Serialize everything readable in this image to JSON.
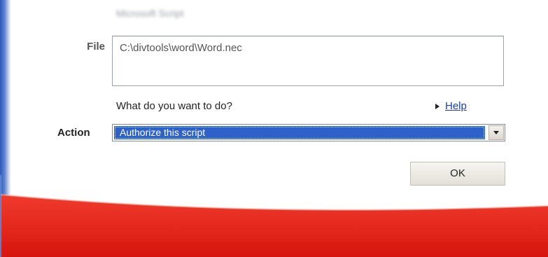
{
  "header": {
    "title": "Microsoft Script"
  },
  "file": {
    "label": "File",
    "path": "C:\\divtools\\word\\Word.nec"
  },
  "prompt": {
    "question": "What do you want to do?",
    "help_label": "Help"
  },
  "action": {
    "label": "Action",
    "selected": "Authorize this script"
  },
  "buttons": {
    "ok_label": "OK"
  },
  "colors": {
    "selection": "#2f62c9",
    "link": "#1a3fb0",
    "swoosh": "#e8231b",
    "accent_blue": "#2d5ab8"
  }
}
